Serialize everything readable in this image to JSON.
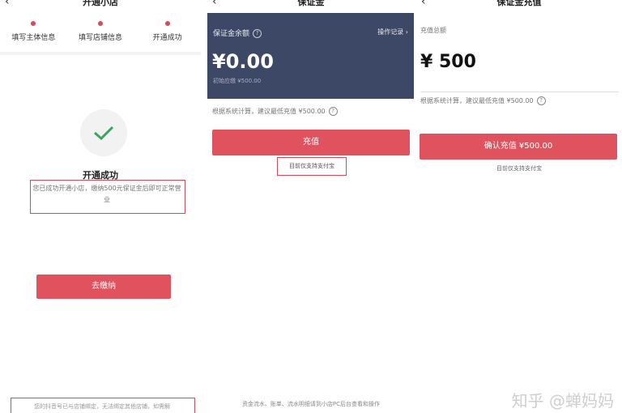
{
  "panel1": {
    "title": "开通小店",
    "back_icon": "‹",
    "steps": [
      {
        "label": "填写主体信息"
      },
      {
        "label": "填写店铺信息"
      },
      {
        "label": "开通成功"
      }
    ],
    "success_title": "开通成功",
    "success_message": "您已成功开通小店，缴纳500元保证金后即可正常营业",
    "pay_button": "去缴纳",
    "bottom_note": "您的抖音号已与店铺绑定，无法绑定其他店铺，如需解"
  },
  "panel2": {
    "title": "保证金",
    "back_icon": "‹",
    "card_label": "保证金余额",
    "card_link": "操作记录 ›",
    "balance": "¥0.00",
    "initial_amount": "初始应缴 ¥500.00",
    "suggestion": "根据系统计算，建议最低充值 ¥500.00",
    "recharge_button": "充值",
    "alipay_note": "目前仅支持支付宝",
    "bottom_note": "资金流水、账单、流水明细请到小店PC后台查看和操作"
  },
  "panel3": {
    "title": "保证金充值",
    "back_icon": "‹",
    "amount_label": "充值总额",
    "amount": "¥ 500",
    "suggestion": "根据系统计算，建议最低充值 ¥500.00",
    "confirm_button": "确认充值 ¥500.00",
    "alipay_note": "目前仅支持支付宝"
  },
  "watermark": "知乎 @蝉妈妈",
  "colors": {
    "accent": "#e0525e",
    "card": "#3d4766"
  }
}
